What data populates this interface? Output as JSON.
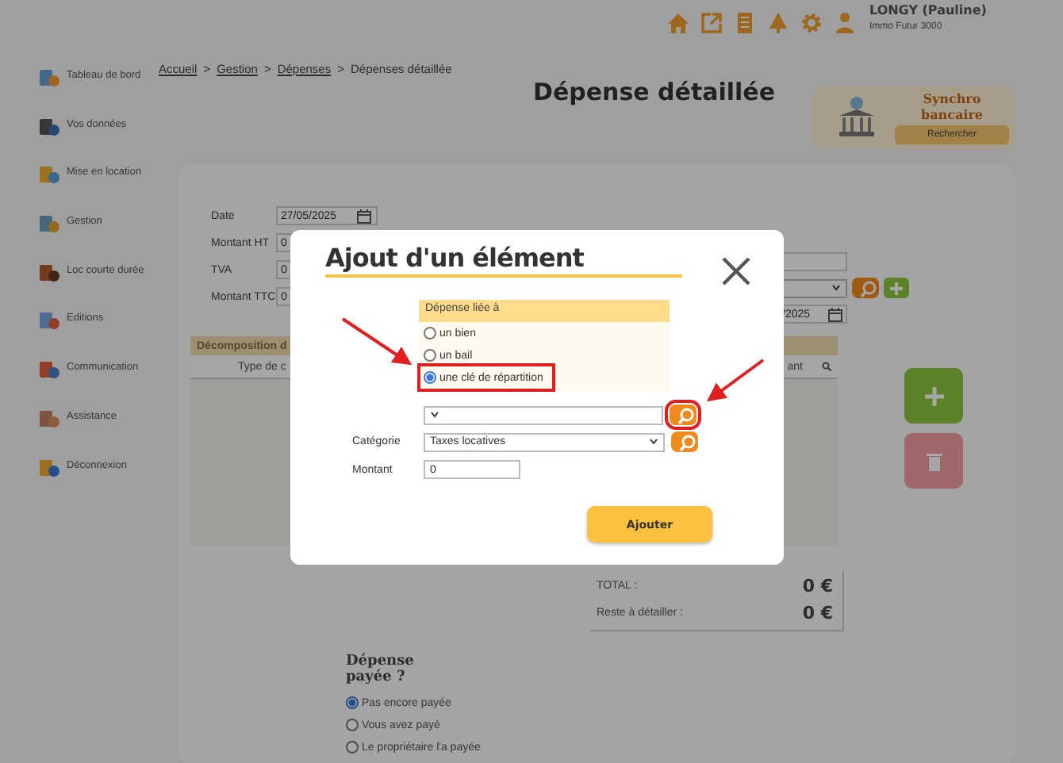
{
  "header": {
    "user_name": "LONGY (Pauline)",
    "company": "Immo Futur 3000"
  },
  "sidebar": {
    "items": [
      {
        "label": "Tableau de bord"
      },
      {
        "label": "Vos données"
      },
      {
        "label": "Mise en location"
      },
      {
        "label": "Gestion"
      },
      {
        "label": "Loc courte durée"
      },
      {
        "label": "Editions"
      },
      {
        "label": "Communication"
      },
      {
        "label": "Assistance"
      },
      {
        "label": "Déconnexion"
      }
    ]
  },
  "breadcrumb": {
    "separator": ">",
    "items": [
      {
        "label": "Accueil",
        "link": true
      },
      {
        "label": "Gestion",
        "link": true
      },
      {
        "label": "Dépenses",
        "link": true
      },
      {
        "label": "Dépenses détaillée",
        "link": false
      }
    ]
  },
  "page_title": "Dépense détaillée",
  "sync_card": {
    "title": "Synchro bancaire",
    "button": "Rechercher"
  },
  "form": {
    "fields": [
      {
        "label": "Date",
        "value": "27/05/2025",
        "kind": "date"
      },
      {
        "label": "Montant HT",
        "value": "0",
        "kind": "text"
      },
      {
        "label": "TVA",
        "value": "0",
        "kind": "text"
      },
      {
        "label": "Montant TTC",
        "value": "0",
        "kind": "text"
      }
    ],
    "right_date": {
      "value": "/2025"
    }
  },
  "decomposition": {
    "title": "Décomposition d",
    "columns": [
      "Type de c",
      "ant"
    ]
  },
  "totals": [
    {
      "label": "TOTAL :",
      "value": "0 €"
    },
    {
      "label": "Reste à détailler :",
      "value": "0 €"
    }
  ],
  "payment": {
    "title": "Dépense payée ?",
    "options": [
      {
        "label": "Pas encore payée",
        "selected": true
      },
      {
        "label": "Vous avez payé",
        "selected": false
      },
      {
        "label": "Le propriétaire l'a payée",
        "selected": false
      }
    ]
  },
  "modal": {
    "title": "Ajout d'un élément",
    "linked_to": {
      "header": "Dépense liée à",
      "options": [
        {
          "label": "un bien",
          "selected": false,
          "highlighted": false
        },
        {
          "label": "un bail",
          "selected": false,
          "highlighted": false
        },
        {
          "label": "une clé de répartition",
          "selected": true,
          "highlighted": true
        }
      ]
    },
    "selector": {
      "search_highlighted": true
    },
    "category": {
      "label": "Catégorie",
      "value": "Taxes locatives"
    },
    "amount": {
      "label": "Montant",
      "value": "0"
    },
    "submit": "Ajouter"
  }
}
